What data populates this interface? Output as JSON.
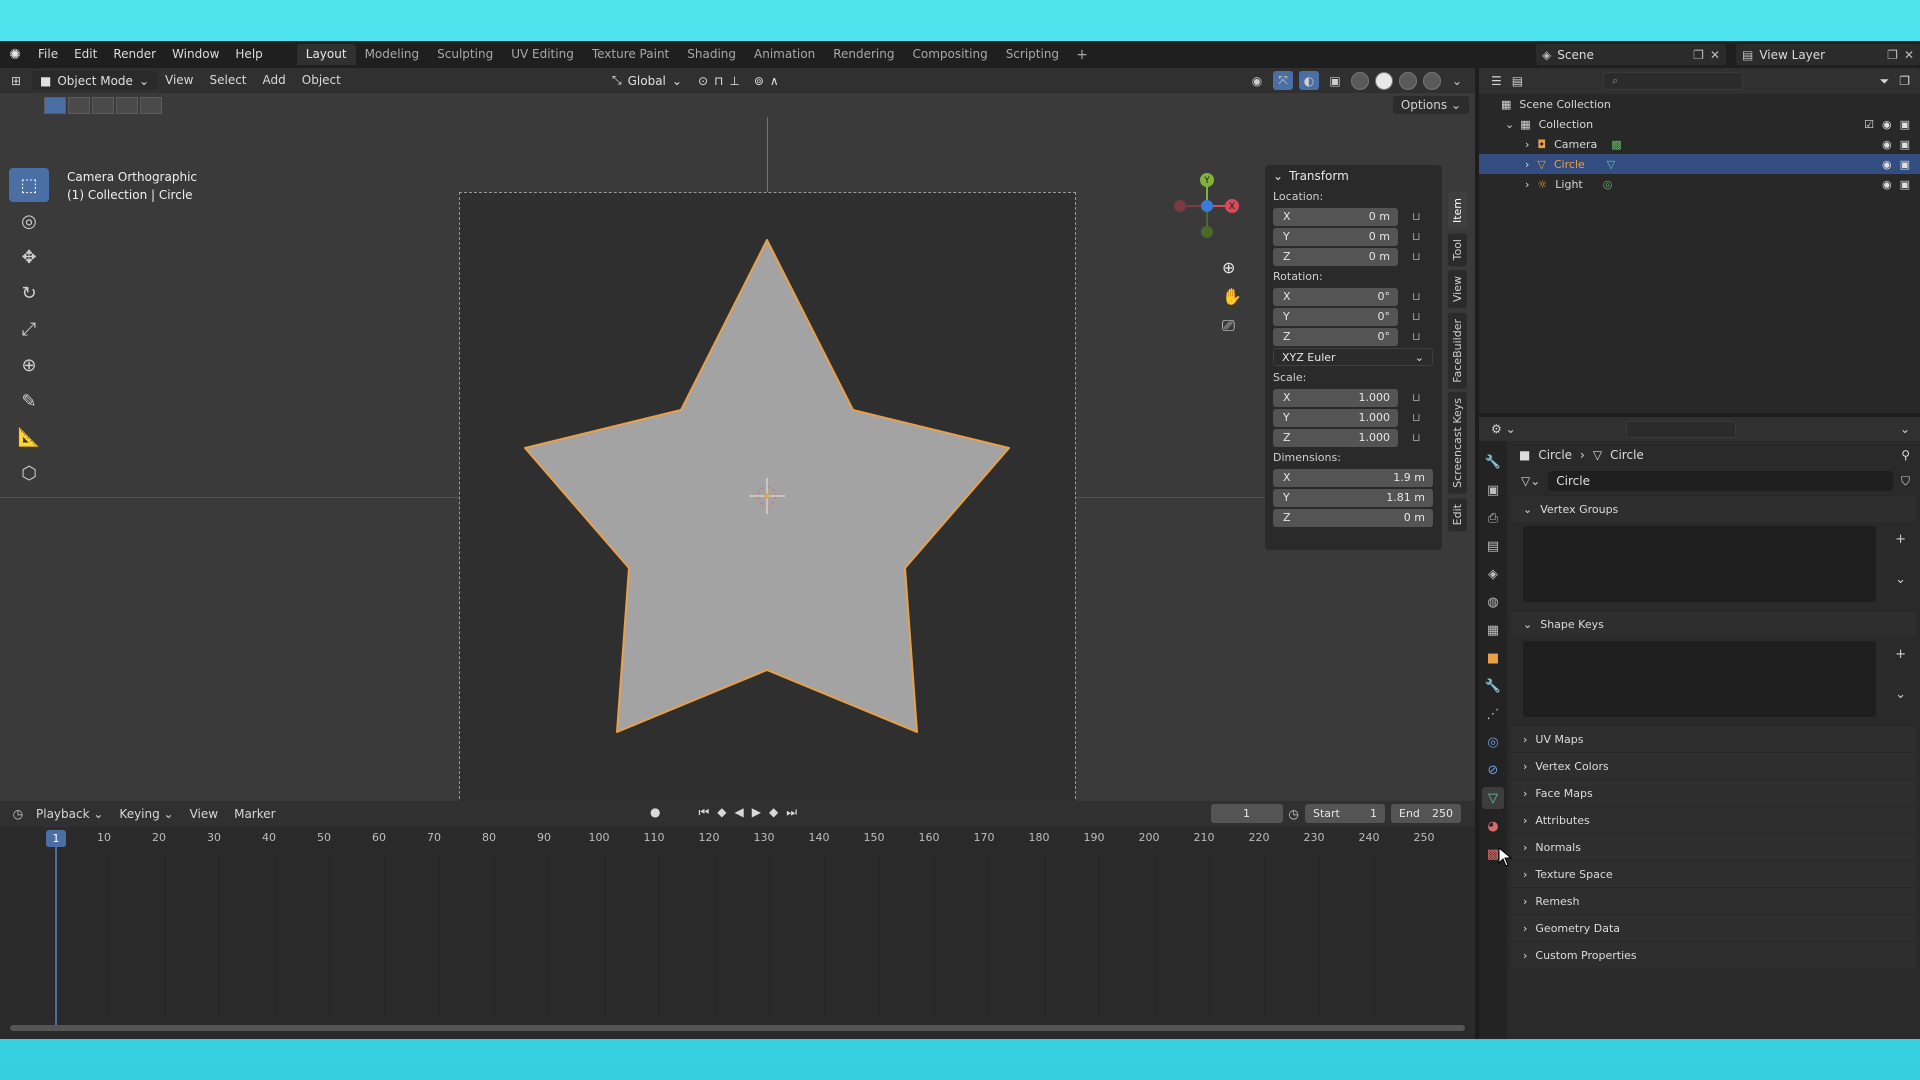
{
  "topbar": {
    "menu": [
      "File",
      "Edit",
      "Render",
      "Window",
      "Help"
    ],
    "workspaces": [
      "Layout",
      "Modeling",
      "Sculpting",
      "UV Editing",
      "Texture Paint",
      "Shading",
      "Animation",
      "Rendering",
      "Compositing",
      "Scripting"
    ],
    "active_workspace": "Layout",
    "scene": "Scene",
    "view_layer": "View Layer"
  },
  "viewport": {
    "mode": "Object Mode",
    "menu": [
      "View",
      "Select",
      "Add",
      "Object"
    ],
    "orientation": "Global",
    "options_label": "Options",
    "camera_info": [
      "Camera Orthographic",
      "(1) Collection | Circle"
    ]
  },
  "transform": {
    "title": "Transform",
    "location_label": "Location:",
    "location": [
      {
        "axis": "X",
        "value": "0 m"
      },
      {
        "axis": "Y",
        "value": "0 m"
      },
      {
        "axis": "Z",
        "value": "0 m"
      }
    ],
    "rotation_label": "Rotation:",
    "rotation": [
      {
        "axis": "X",
        "value": "0°"
      },
      {
        "axis": "Y",
        "value": "0°"
      },
      {
        "axis": "Z",
        "value": "0°"
      }
    ],
    "rotation_mode": "XYZ Euler",
    "scale_label": "Scale:",
    "scale": [
      {
        "axis": "X",
        "value": "1.000"
      },
      {
        "axis": "Y",
        "value": "1.000"
      },
      {
        "axis": "Z",
        "value": "1.000"
      }
    ],
    "dimensions_label": "Dimensions:",
    "dimensions": [
      {
        "axis": "X",
        "value": "1.9 m"
      },
      {
        "axis": "Y",
        "value": "1.81 m"
      },
      {
        "axis": "Z",
        "value": "0 m"
      }
    ]
  },
  "side_tabs": [
    "Item",
    "Tool",
    "View",
    "FaceBuilder",
    "Screencast Keys",
    "Edit"
  ],
  "gizmo": {
    "x": "X",
    "y": "Y"
  },
  "timeline": {
    "menu": [
      "Playback",
      "Keying",
      "View",
      "Marker"
    ],
    "current_frame": "1",
    "start_label": "Start",
    "start": "1",
    "end_label": "End",
    "end": "250",
    "ticks": [
      "1",
      "10",
      "20",
      "30",
      "40",
      "50",
      "60",
      "70",
      "80",
      "90",
      "100",
      "110",
      "120",
      "130",
      "140",
      "150",
      "160",
      "170",
      "180",
      "190",
      "200",
      "210",
      "220",
      "230",
      "240",
      "250"
    ]
  },
  "outliner": {
    "scene_collection": "Scene Collection",
    "collection": "Collection",
    "items": [
      "Camera",
      "Circle",
      "Light"
    ]
  },
  "properties": {
    "breadcrumb_object": "Circle",
    "breadcrumb_mesh": "Circle",
    "mesh_name": "Circle",
    "panels": {
      "vertex_groups": "Vertex Groups",
      "shape_keys": "Shape Keys",
      "collapsed": [
        "UV Maps",
        "Vertex Colors",
        "Face Maps",
        "Attributes",
        "Normals",
        "Texture Space",
        "Remesh",
        "Geometry Data",
        "Custom Properties"
      ]
    }
  },
  "colors": {
    "accent": "#4b6fa5",
    "selection": "#e8a04a",
    "star_fill": "#a3a3a3"
  }
}
